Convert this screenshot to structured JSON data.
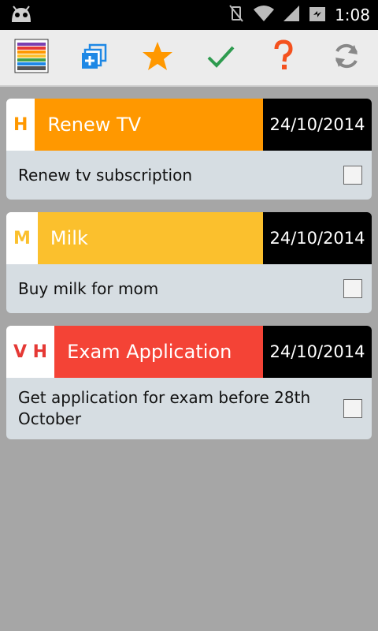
{
  "status_bar": {
    "time": "1:08"
  },
  "toolbar": {
    "buttons": [
      {
        "icon": "app-logo-icon"
      },
      {
        "icon": "add-new-icon"
      },
      {
        "icon": "star-icon"
      },
      {
        "icon": "check-icon"
      },
      {
        "icon": "help-icon"
      },
      {
        "icon": "refresh-icon"
      }
    ]
  },
  "tasks": [
    {
      "priority": "H",
      "title": "Renew TV",
      "date": "24/10/2014",
      "description": "Renew tv subscription",
      "color": "#ff9800",
      "priority_color": "#ff9800"
    },
    {
      "priority": "M",
      "title": "Milk",
      "date": "24/10/2014",
      "description": "Buy milk for mom",
      "color": "#fbc02d",
      "priority_color": "#fbc02d"
    },
    {
      "priority": "V H",
      "title": "Exam Application",
      "date": "24/10/2014",
      "description": "Get application for exam before 28th October",
      "color": "#f44336",
      "priority_color": "#e53935"
    }
  ]
}
